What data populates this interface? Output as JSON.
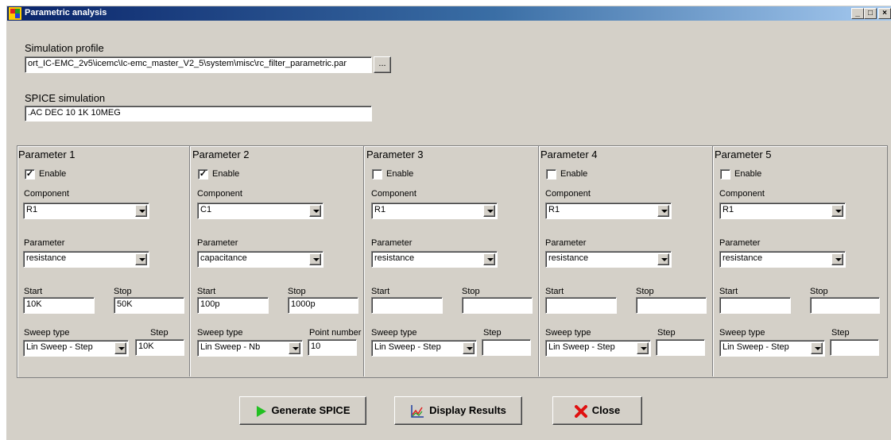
{
  "window": {
    "title": "Parametric analysis",
    "minimize": "_",
    "maximize": "□",
    "close": "×"
  },
  "profile": {
    "label": "Simulation profile",
    "value": "ort_IC-EMC_2v5\\icemc\\Ic-emc_master_V2_5\\system\\misc\\rc_filter_parametric.par",
    "browse": "..."
  },
  "spice": {
    "label": "SPICE simulation",
    "value": ".AC DEC 10 1K 10MEG"
  },
  "params": [
    {
      "title": "Parameter 1",
      "enable_label": "Enable",
      "enabled": "✓",
      "component_label": "Component",
      "component": "R1",
      "parameter_label": "Parameter",
      "parameter": "resistance",
      "start_label": "Start",
      "start": "10K",
      "stop_label": "Stop",
      "stop": "50K",
      "sweep_label": "Sweep type",
      "sweep": "Lin Sweep - Step",
      "step_label": "Step",
      "step": "10K"
    },
    {
      "title": "Parameter 2",
      "enable_label": "Enable",
      "enabled": "✓",
      "component_label": "Component",
      "component": "C1",
      "parameter_label": "Parameter",
      "parameter": "capacitance",
      "start_label": "Start",
      "start": "100p",
      "stop_label": "Stop",
      "stop": "1000p",
      "sweep_label": "Sweep type",
      "sweep": "Lin Sweep - Nb",
      "step_label": "Point number",
      "step": "10"
    },
    {
      "title": "Parameter 3",
      "enable_label": "Enable",
      "enabled": "",
      "component_label": "Component",
      "component": "R1",
      "parameter_label": "Parameter",
      "parameter": "resistance",
      "start_label": "Start",
      "start": "",
      "stop_label": "Stop",
      "stop": "",
      "sweep_label": "Sweep type",
      "sweep": "Lin Sweep - Step",
      "step_label": "Step",
      "step": ""
    },
    {
      "title": "Parameter 4",
      "enable_label": "Enable",
      "enabled": "",
      "component_label": "Component",
      "component": "R1",
      "parameter_label": "Parameter",
      "parameter": "resistance",
      "start_label": "Start",
      "start": "",
      "stop_label": "Stop",
      "stop": "",
      "sweep_label": "Sweep type",
      "sweep": "Lin Sweep - Step",
      "step_label": "Step",
      "step": ""
    },
    {
      "title": "Parameter 5",
      "enable_label": "Enable",
      "enabled": "",
      "component_label": "Component",
      "component": "R1",
      "parameter_label": "Parameter",
      "parameter": "resistance",
      "start_label": "Start",
      "start": "",
      "stop_label": "Stop",
      "stop": "",
      "sweep_label": "Sweep type",
      "sweep": "Lin Sweep - Step",
      "step_label": "Step",
      "step": ""
    }
  ],
  "buttons": {
    "generate": "Generate SPICE",
    "display": "Display Results",
    "close": "Close"
  },
  "icons": {
    "app": "app-icon",
    "generate": "play-arrow-icon",
    "display": "chart-icon",
    "close": "red-x-icon"
  },
  "colors": {
    "title_start": "#0a246a",
    "title_end": "#a6caf0",
    "play": "#22c022",
    "close_x": "#e01010"
  }
}
